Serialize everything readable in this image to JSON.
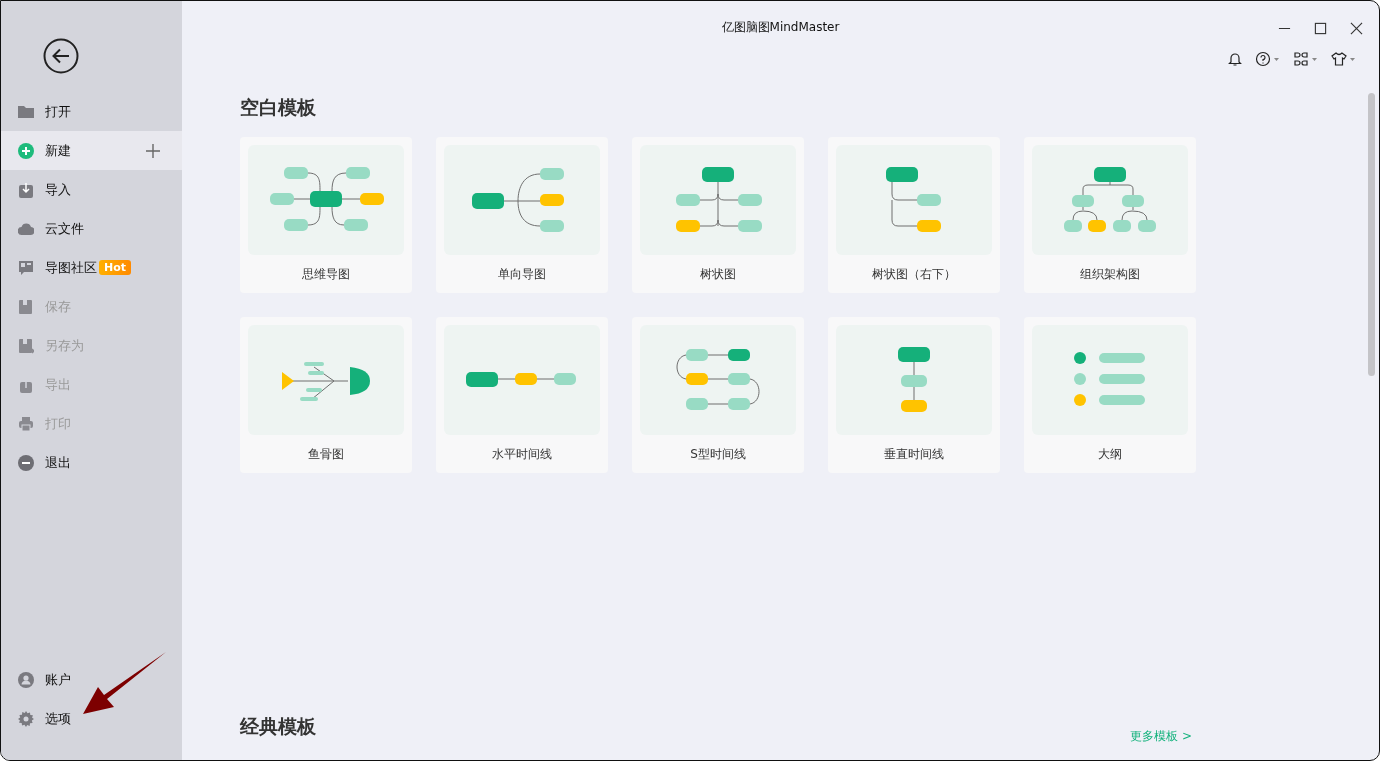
{
  "window": {
    "title": "亿图脑图MindMaster"
  },
  "sidebar": {
    "items": [
      {
        "label": "打开",
        "selected": false,
        "disabled": false
      },
      {
        "label": "新建",
        "selected": true,
        "disabled": false
      },
      {
        "label": "导入",
        "selected": false,
        "disabled": false
      },
      {
        "label": "云文件",
        "selected": false,
        "disabled": false
      },
      {
        "label": "导图社区",
        "badge": "Hot",
        "selected": false,
        "disabled": false
      },
      {
        "label": "保存",
        "selected": false,
        "disabled": true
      },
      {
        "label": "另存为",
        "selected": false,
        "disabled": true
      },
      {
        "label": "导出",
        "selected": false,
        "disabled": true
      },
      {
        "label": "打印",
        "selected": false,
        "disabled": true
      },
      {
        "label": "退出",
        "selected": false,
        "disabled": false
      }
    ],
    "bottom_items": [
      {
        "label": "账户",
        "selected": false,
        "disabled": false
      },
      {
        "label": "选项",
        "selected": false,
        "disabled": false
      }
    ]
  },
  "blank_templates": {
    "heading": "空白模板",
    "items": [
      {
        "kind": "mindmap",
        "label": "思维导图"
      },
      {
        "kind": "right-map",
        "label": "单向导图"
      },
      {
        "kind": "tree",
        "label": "树状图"
      },
      {
        "kind": "tree-right",
        "label": "树状图（右下）"
      },
      {
        "kind": "org",
        "label": "组织架构图"
      },
      {
        "kind": "fishbone",
        "label": "鱼骨图"
      },
      {
        "kind": "h-timeline",
        "label": "水平时间线"
      },
      {
        "kind": "s-timeline",
        "label": "S型时间线"
      },
      {
        "kind": "v-timeline",
        "label": "垂直时间线"
      },
      {
        "kind": "outline",
        "label": "大纲"
      }
    ]
  },
  "classic_templates": {
    "heading": "经典模板",
    "more_link": "更多模板 >"
  }
}
